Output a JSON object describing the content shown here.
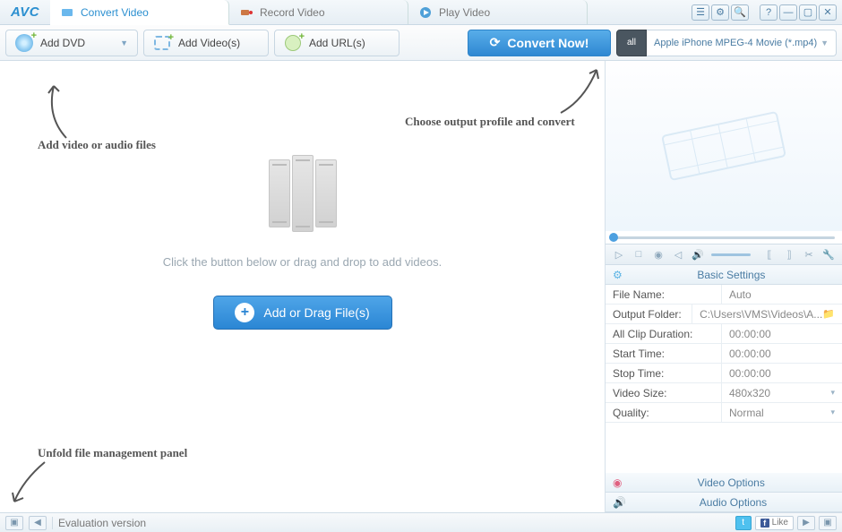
{
  "app": {
    "logo": "AVC"
  },
  "tabs": [
    {
      "label": "Convert Video",
      "icon": "convert-icon",
      "active": true
    },
    {
      "label": "Record Video",
      "icon": "record-icon",
      "active": false
    },
    {
      "label": "Play Video",
      "icon": "play-icon",
      "active": false
    }
  ],
  "toolbar": {
    "add_dvd": "Add DVD",
    "add_videos": "Add Video(s)",
    "add_urls": "Add URL(s)",
    "convert_now": "Convert Now!",
    "profile": "Apple iPhone MPEG-4 Movie (*.mp4)",
    "profile_badge": "all"
  },
  "main": {
    "hint": "Click the button below or drag and drop to add videos.",
    "add_button": "Add or Drag File(s)"
  },
  "annotations": {
    "add_files": "Add video or audio files",
    "choose_profile": "Choose output profile and convert",
    "unfold_panel": "Unfold file management panel"
  },
  "settings": {
    "header": "Basic Settings",
    "rows": [
      {
        "label": "File Name:",
        "value": "Auto",
        "dropdown": false
      },
      {
        "label": "Output Folder:",
        "value": "C:\\Users\\VMS\\Videos\\A...",
        "folder": true
      },
      {
        "label": "All Clip Duration:",
        "value": "00:00:00"
      },
      {
        "label": "Start Time:",
        "value": "00:00:00"
      },
      {
        "label": "Stop Time:",
        "value": "00:00:00"
      },
      {
        "label": "Video Size:",
        "value": "480x320",
        "dropdown": true
      },
      {
        "label": "Quality:",
        "value": "Normal",
        "dropdown": true
      }
    ],
    "video_options": "Video Options",
    "audio_options": "Audio Options"
  },
  "status": {
    "text": "Evaluation version",
    "like": "Like"
  }
}
